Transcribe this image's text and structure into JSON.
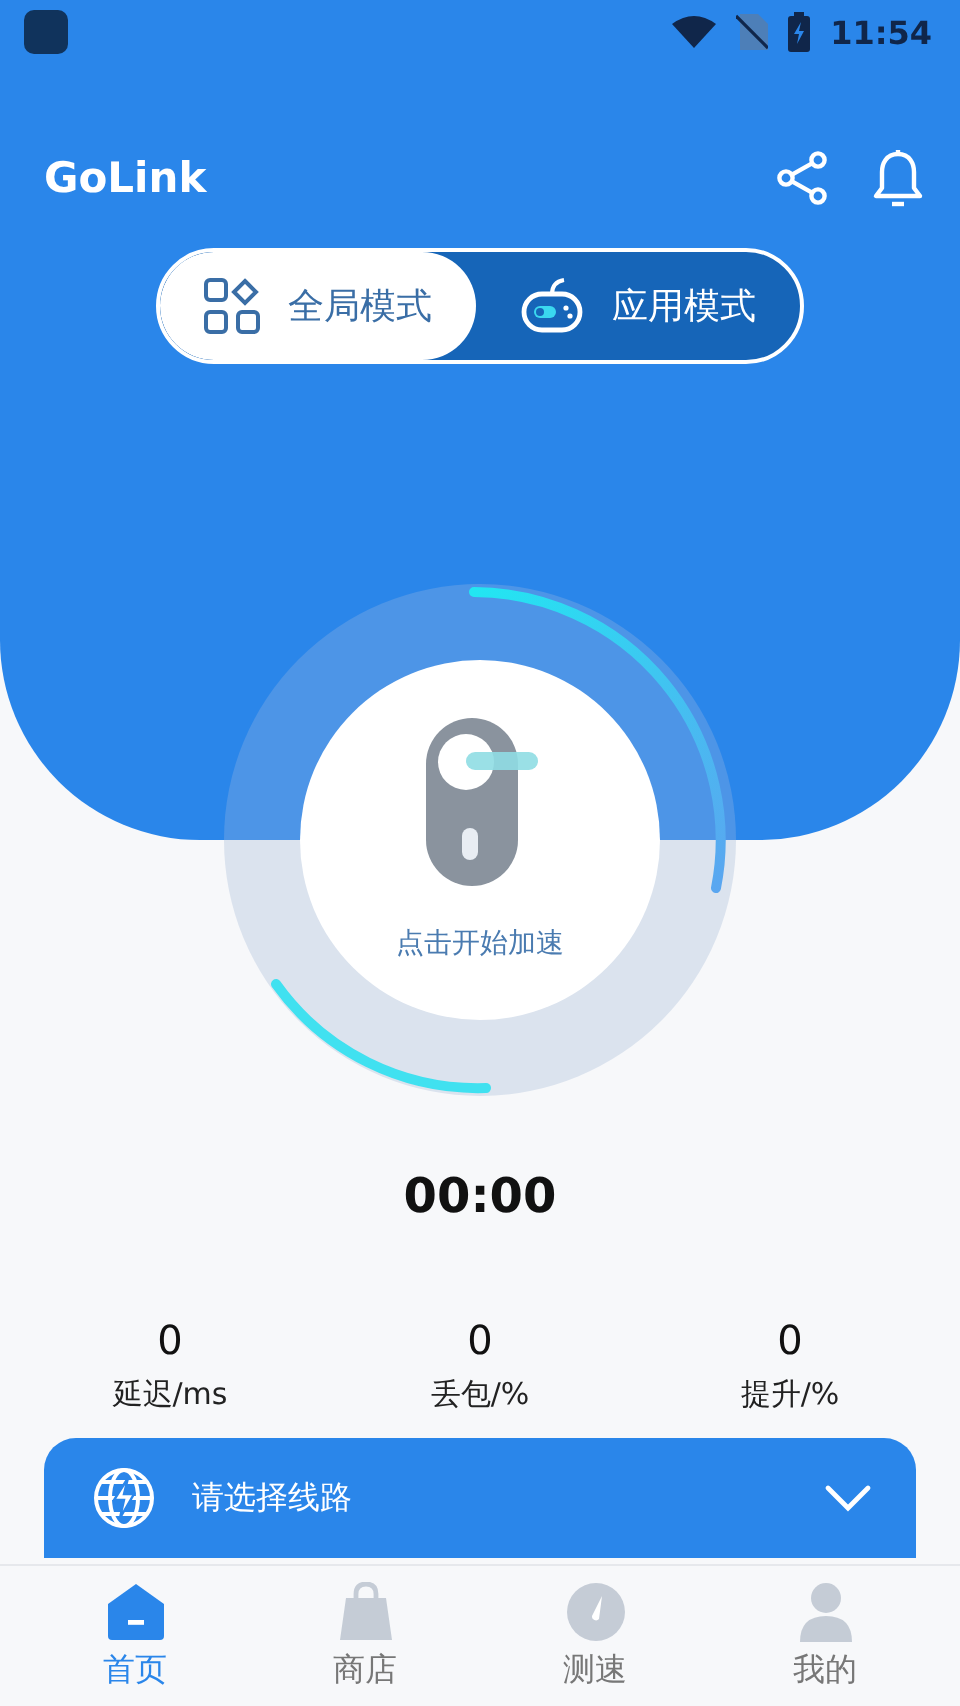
{
  "status_bar": {
    "time": "11:54"
  },
  "header": {
    "title": "GoLink"
  },
  "modes": [
    {
      "label": "全局模式",
      "kind": "grid",
      "selected": true
    },
    {
      "label": "应用模式",
      "kind": "gamepad",
      "selected": false
    }
  ],
  "dial": {
    "label": "点击开始加速"
  },
  "timer": "00:00",
  "stats": [
    {
      "value": "0",
      "label": "延迟/ms"
    },
    {
      "value": "0",
      "label": "丢包/%"
    },
    {
      "value": "0",
      "label": "提升/%"
    }
  ],
  "route": {
    "label": "请选择线路"
  },
  "nav": [
    {
      "label": "首页",
      "kind": "home",
      "selected": true
    },
    {
      "label": "商店",
      "kind": "bag",
      "selected": false
    },
    {
      "label": "测速",
      "kind": "gauge",
      "selected": false
    },
    {
      "label": "我的",
      "kind": "person",
      "selected": false
    }
  ]
}
